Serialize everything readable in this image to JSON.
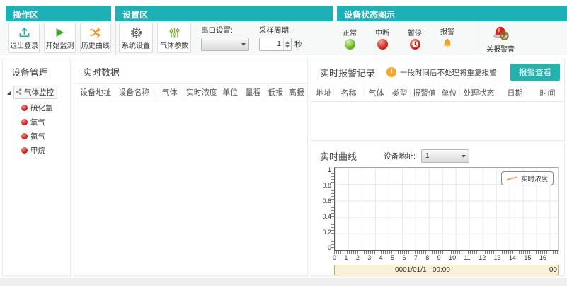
{
  "toolbar": {
    "groups": {
      "operation": "操作区",
      "settings": "设置区",
      "status": "设备状态图示"
    },
    "buttons": {
      "logout": "退出登录",
      "start": "开始监测",
      "history": "历史曲线",
      "system": "系统设置",
      "gas_params": "气体参数"
    },
    "serial_label": "串口设置:",
    "serial_value": "",
    "sample_label": "采样周期:",
    "sample_value": "1",
    "sample_unit": "秒",
    "status_items": [
      {
        "label": "正常"
      },
      {
        "label": "中断"
      },
      {
        "label": "暂停"
      },
      {
        "label": "报警"
      }
    ],
    "mute_label": "关报警音"
  },
  "sidebar": {
    "title": "设备管理",
    "root": "气体监控",
    "items": [
      "硫化氢",
      "氧气",
      "氨气",
      "甲烷"
    ]
  },
  "realtime_table": {
    "title": "实时数据",
    "columns": [
      "设备地址",
      "设备名称",
      "气体",
      "实时浓度",
      "单位",
      "量程",
      "低报",
      "高报"
    ],
    "rows": []
  },
  "alarm_panel": {
    "title": "实时报警记录",
    "info_icon_glyph": "i",
    "notice": "一段时间后不处理将重复报警",
    "view_button": "报警查看",
    "columns": [
      "地址",
      "名称",
      "气体",
      "类型",
      "报警值",
      "单位",
      "处理状态",
      "日期",
      "时间"
    ],
    "rows": []
  },
  "curve_panel": {
    "title": "实时曲线",
    "device_label": "设备地址:",
    "device_value": "1",
    "chart_data": {
      "type": "line",
      "title": "",
      "series": [
        {
          "name": "实时浓度",
          "values": []
        }
      ],
      "x_ticks": [
        "0",
        "1",
        "2",
        "3",
        "4",
        "5",
        "6",
        "7",
        "8",
        "9",
        "10",
        "11",
        "12",
        "13",
        "14",
        "15",
        "16"
      ],
      "y_ticks": [
        "1",
        "0.8",
        "0.6",
        "0.4",
        "0.2",
        "0"
      ],
      "xlim": [
        0,
        16.6
      ],
      "ylim": [
        0,
        1
      ],
      "grid": true,
      "legend_position": "top-right",
      "line_color": "#f2a285",
      "scrollbar_label": "0001/01/1   00:00",
      "scrollbar_right_label": "00"
    }
  },
  "colors": {
    "accent_teal": "#1db1b5",
    "button_teal": "#25b2af",
    "status_green": "#58a812",
    "status_red": "#c70d0d",
    "alarm_orange": "#f5a623",
    "curve_salmon": "#f2a285"
  }
}
